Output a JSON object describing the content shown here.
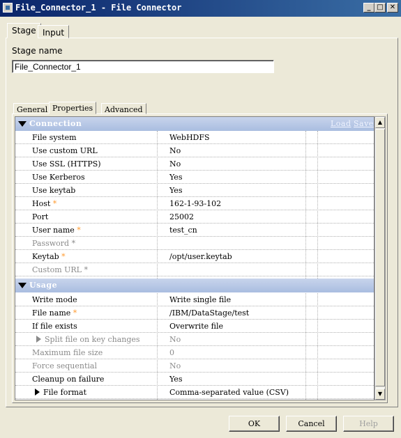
{
  "window": {
    "title": "File_Connector_1 - File Connector",
    "min": "_",
    "max": "□",
    "close": "✕"
  },
  "top_tabs": [
    {
      "label": "Stage"
    },
    {
      "label": "Input"
    }
  ],
  "stage": {
    "label": "Stage name",
    "value": "File_Connector_1"
  },
  "inner_tabs": [
    {
      "label": "General"
    },
    {
      "label": "Properties"
    },
    {
      "label": "Advanced"
    }
  ],
  "connection": {
    "label": "Connection",
    "load": "Load",
    "save": "Save",
    "rows": [
      {
        "name": "File system",
        "value": "WebHDFS",
        "required": false,
        "disabled": false
      },
      {
        "name": "Use custom URL",
        "value": "No",
        "required": false,
        "disabled": false
      },
      {
        "name": "Use SSL (HTTPS)",
        "value": "No",
        "required": false,
        "disabled": false
      },
      {
        "name": "Use Kerberos",
        "value": "Yes",
        "required": false,
        "disabled": false
      },
      {
        "name": "Use keytab",
        "value": "Yes",
        "required": false,
        "disabled": false
      },
      {
        "name": "Host",
        "value": "162-1-93-102",
        "required": true,
        "disabled": false
      },
      {
        "name": "Port",
        "value": "25002",
        "required": false,
        "disabled": false
      },
      {
        "name": "User name",
        "value": "test_cn",
        "required": true,
        "disabled": false
      },
      {
        "name": "Password",
        "value": "",
        "required": true,
        "disabled": true
      },
      {
        "name": "Keytab",
        "value": "/opt/user.keytab",
        "required": true,
        "disabled": false
      },
      {
        "name": "Custom URL",
        "value": "",
        "required": true,
        "disabled": true
      }
    ]
  },
  "usage": {
    "label": "Usage",
    "rows": [
      {
        "name": "Write mode",
        "value": "Write single file",
        "required": false,
        "disabled": false
      },
      {
        "name": "File name",
        "value": "/IBM/DataStage/test",
        "required": true,
        "disabled": false
      },
      {
        "name": "If file exists",
        "value": "Overwrite file",
        "required": false,
        "disabled": false
      },
      {
        "name": "Split file on key changes",
        "value": "No",
        "required": false,
        "disabled": true
      },
      {
        "name": "Maximum file size",
        "value": "0",
        "required": false,
        "disabled": true
      },
      {
        "name": "Force sequential",
        "value": "No",
        "required": false,
        "disabled": true
      },
      {
        "name": "Cleanup on failure",
        "value": "Yes",
        "required": false,
        "disabled": false
      },
      {
        "name": "File format",
        "value": "Comma-separated value (CSV)",
        "required": false,
        "disabled": false
      }
    ]
  },
  "star": "*",
  "buttons": {
    "ok": "OK",
    "cancel": "Cancel",
    "help": "Help"
  }
}
